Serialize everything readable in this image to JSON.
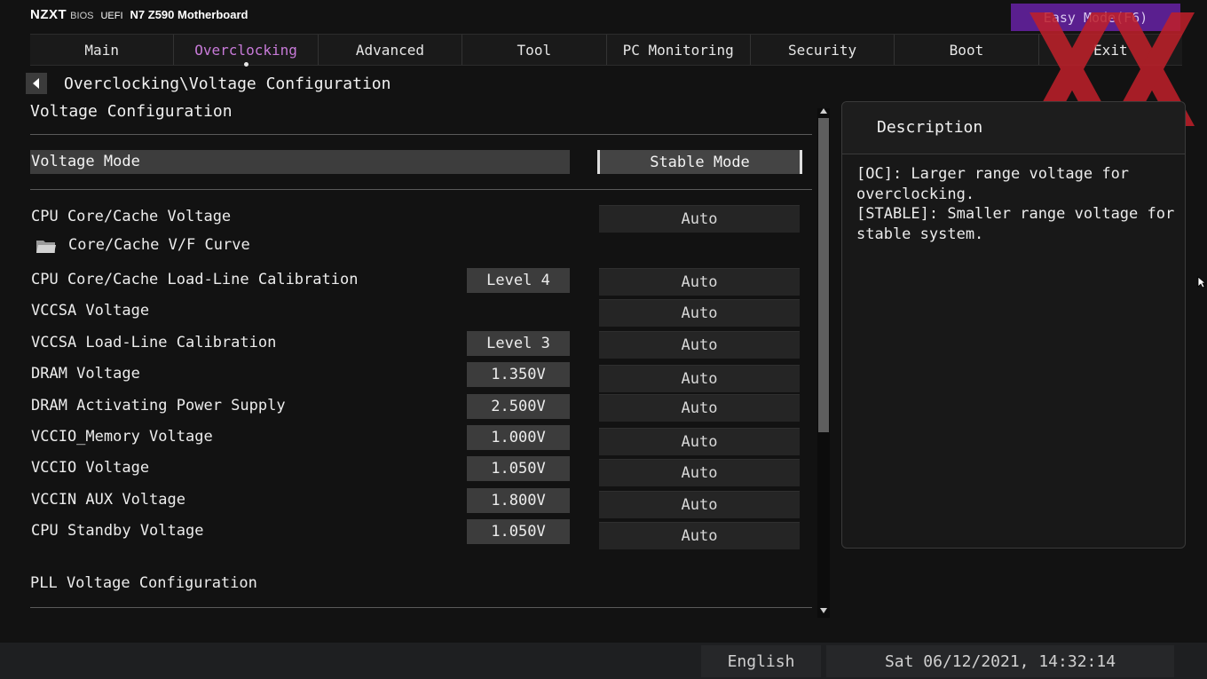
{
  "brand": {
    "logo_text": "NZXT",
    "bios": "BIOS",
    "uefi": "UEFI",
    "model": "N7 Z590 Motherboard"
  },
  "easy_mode_label": "Easy Mode(F6)",
  "tabs": [
    {
      "label": "Main",
      "active": false
    },
    {
      "label": "Overclocking",
      "active": true
    },
    {
      "label": "Advanced",
      "active": false
    },
    {
      "label": "Tool",
      "active": false
    },
    {
      "label": "PC Monitoring",
      "active": false
    },
    {
      "label": "Security",
      "active": false
    },
    {
      "label": "Boot",
      "active": false
    },
    {
      "label": "Exit",
      "active": false
    }
  ],
  "breadcrumb": "Overclocking\\Voltage Configuration",
  "page_title": "Voltage Configuration",
  "voltage_mode": {
    "label": "Voltage Mode",
    "value": "Stable Mode"
  },
  "settings": [
    {
      "label": "CPU Core/Cache Voltage",
      "current": "",
      "value": "Auto"
    },
    {
      "label": "CPU Core/Cache Load-Line Calibration",
      "current": "Level 4",
      "value": "Auto"
    },
    {
      "label": "VCCSA Voltage",
      "current": "",
      "value": "Auto"
    },
    {
      "label": "VCCSA Load-Line Calibration",
      "current": "Level 3",
      "value": "Auto"
    },
    {
      "label": "DRAM Voltage",
      "current": "1.350V",
      "value": "Auto"
    },
    {
      "label": "DRAM Activating Power Supply",
      "current": "2.500V",
      "value": "Auto"
    },
    {
      "label": "VCCIO_Memory Voltage",
      "current": "1.000V",
      "value": "Auto"
    },
    {
      "label": "VCCIO Voltage",
      "current": "1.050V",
      "value": "Auto"
    },
    {
      "label": "VCCIN AUX Voltage",
      "current": "1.800V",
      "value": "Auto"
    },
    {
      "label": "CPU Standby Voltage",
      "current": "1.050V",
      "value": "Auto"
    }
  ],
  "submenu": {
    "label": "Core/Cache V/F Curve",
    "icon": "folder-icon"
  },
  "pll_section": "PLL Voltage Configuration",
  "description": {
    "title": "Description",
    "text": "[OC]: Larger range voltage for\noverclocking.\n[STABLE]: Smaller range voltage for\nstable system."
  },
  "footer": {
    "language": "English",
    "datetime": "Sat 06/12/2021, 14:32:14"
  },
  "colors": {
    "accent": "#c77ad8",
    "easy_mode_bg": "#5a1f8f",
    "logo_red": "#c0202a"
  }
}
